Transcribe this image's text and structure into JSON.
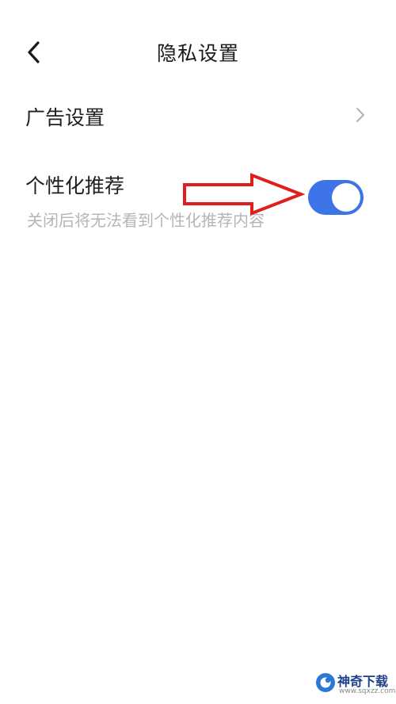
{
  "header": {
    "title": "隐私设置",
    "back_icon": "chevron-left-icon"
  },
  "settings": {
    "ad_settings": {
      "label": "广告设置",
      "icon": "chevron-right-icon"
    },
    "personalized_recommendation": {
      "label": "个性化推荐",
      "description": "关闭后将无法看到个性化推荐内容",
      "enabled": true
    }
  },
  "annotation": {
    "icon": "red-arrow-icon",
    "color": "#e01e1e"
  },
  "watermark": {
    "name": "神奇下载",
    "url": "www.sqxzz.com"
  },
  "colors": {
    "toggle_on": "#3d74e8",
    "description_text": "#b5b5b5"
  }
}
